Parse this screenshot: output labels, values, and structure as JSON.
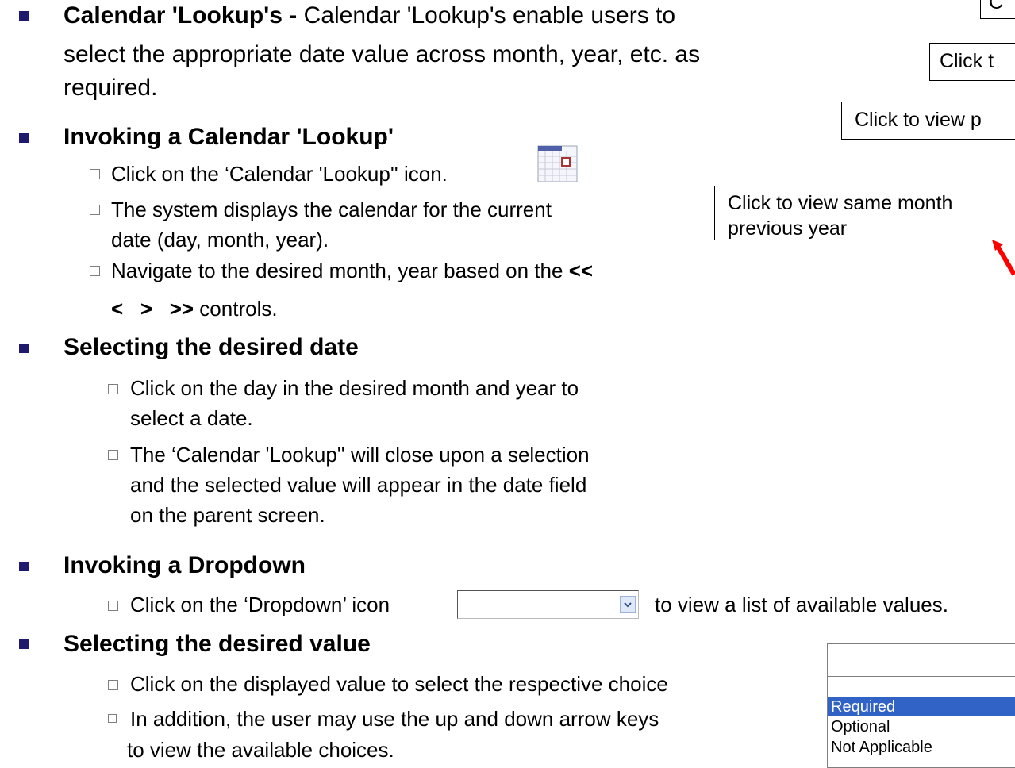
{
  "bullets": {
    "calendar": {
      "title": "Calendar 'Lookup's -",
      "text": " Calendar 'Lookup's enable users to",
      "line2": "select the appropriate date value across month, year, etc. as",
      "line3": "required."
    },
    "invoking_calendar": {
      "title": "Invoking a Calendar 'Lookup'",
      "items": [
        "Click on the ‘Calendar 'Lookup'' icon.",
        "The system displays the calendar for the current",
        "date (day, month, year).",
        "Navigate to the desired month, year based on the ",
        "<<",
        "<   >   >>",
        " controls."
      ]
    },
    "selecting_date": {
      "title": "Selecting the desired date",
      "items": [
        "Click on the day in the desired month and year to",
        "select a date.",
        "The ‘Calendar 'Lookup'' will close upon a selection",
        "and the selected value will appear in the date field",
        "on the parent screen."
      ]
    },
    "invoking_dropdown": {
      "title": "Invoking a Dropdown",
      "before": "Click on the ‘Dropdown’ icon",
      "after": "to view a list of available values."
    },
    "selecting_value": {
      "title": "Selecting the desired value",
      "items": [
        "Click on the displayed value to select the respective choice",
        "In addition, the user may use the up and down arrow keys",
        "to view the available choices."
      ]
    }
  },
  "callouts": {
    "c0": "C",
    "c1": "Click t",
    "c2": "Click to view p",
    "c3_line1": "Click to view same month",
    "c3_line2": "previous year"
  },
  "dropdown_list": {
    "options": [
      "Required",
      "Optional",
      "Not Applicable"
    ],
    "selected": "Required",
    "selected_color": "#3163c6"
  },
  "colors": {
    "bullet": "#1f1a6e",
    "arrow": "#ff0000"
  }
}
